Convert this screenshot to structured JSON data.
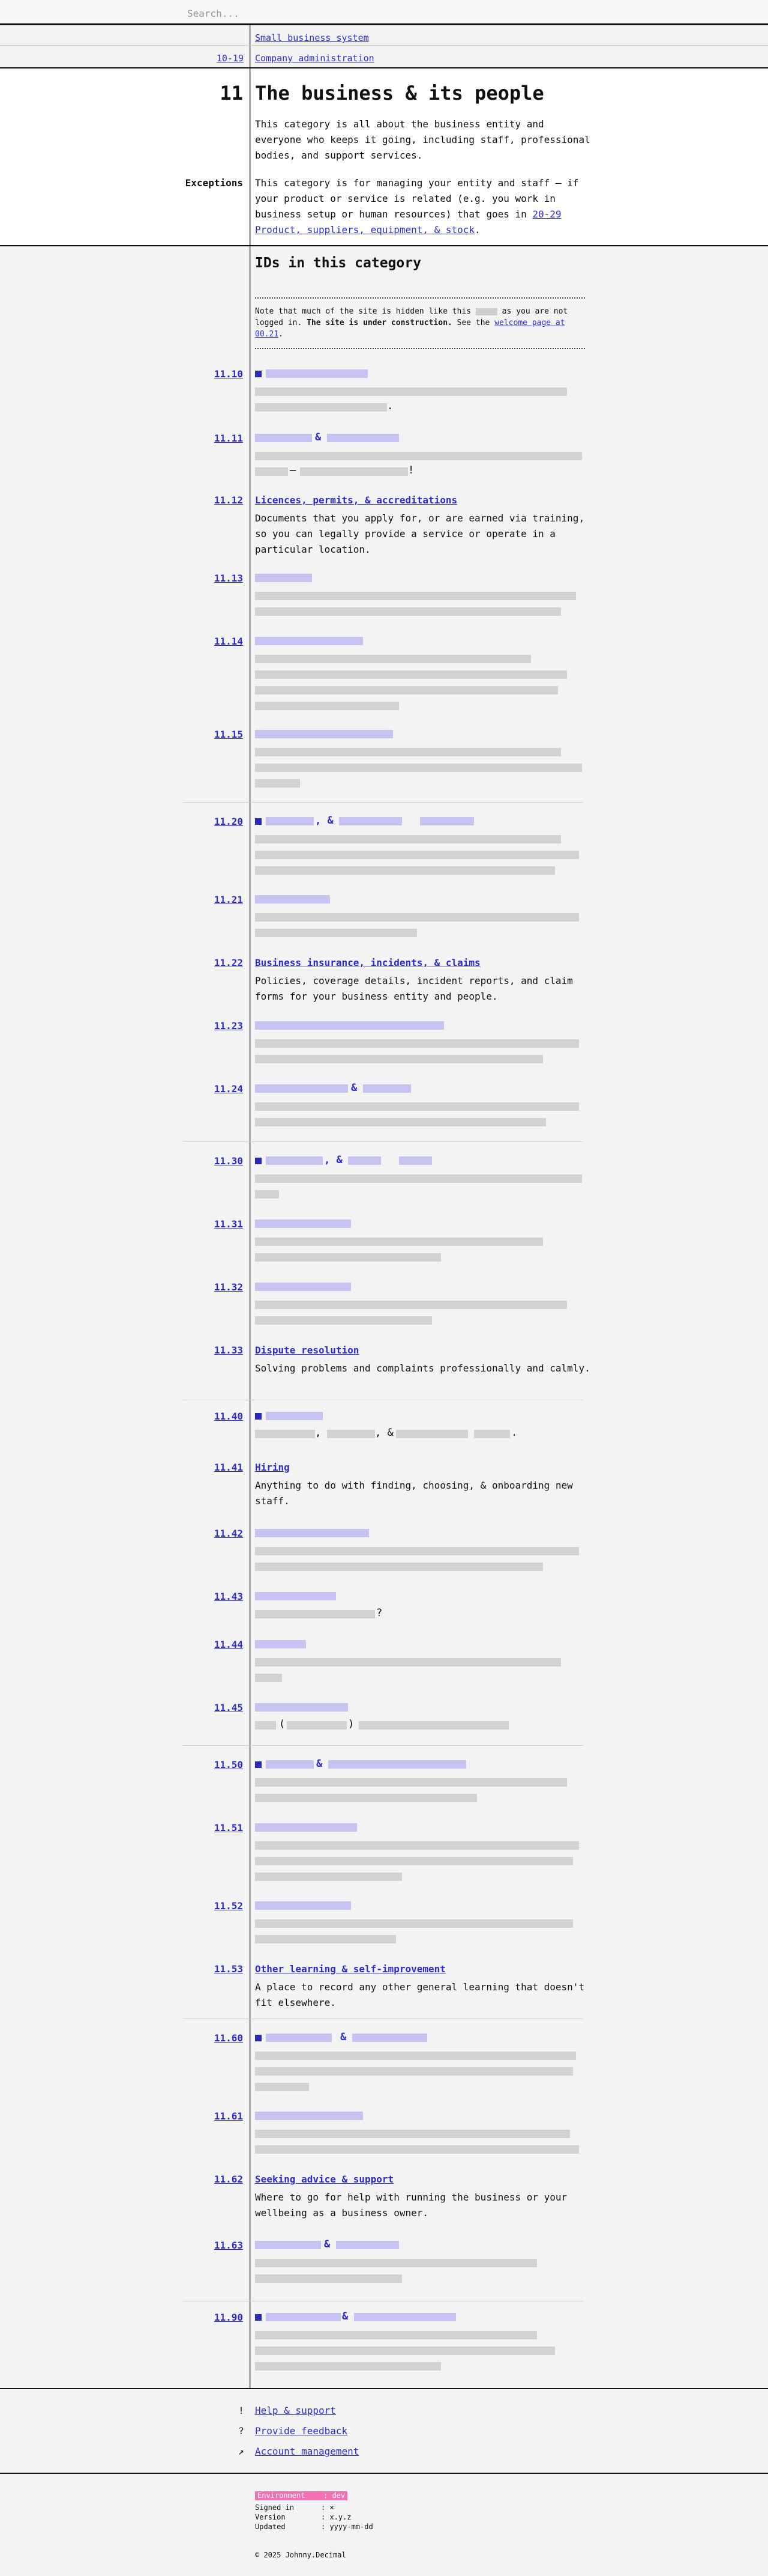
{
  "search": {
    "placeholder": "Search..."
  },
  "breadcrumbs": [
    {
      "num": "",
      "label": "Small business system"
    },
    {
      "num": "10-19",
      "label": "Company administration"
    }
  ],
  "category": {
    "number": "11",
    "title": "The business & its people",
    "description": "This category is all about the business entity and everyone who keeps it going, including staff, professional bodies, and support services.",
    "exceptions_label": "Exceptions",
    "exceptions_text_before": "This category is for managing your entity and staff – if your product or service is related (e.g. you work in business setup or human resources) that goes in ",
    "exceptions_link": "20-29 Product, suppliers, equipment, & stock",
    "exceptions_text_after": "."
  },
  "ids_heading": "IDs in this category",
  "notice": {
    "text1": "Note that much of the site is hidden like this ",
    "text2": " as you are not logged in. ",
    "bold": "The site is under construction.",
    "text3": " See the ",
    "link": "welcome page at 00.21",
    "text4": "."
  },
  "ids": [
    {
      "num": "11.10"
    },
    {
      "num": "11.11"
    },
    {
      "num": "11.12",
      "title": "Licences, permits, & accreditations",
      "desc": "Documents that you apply for, or are earned via training, so you can legally provide a service or operate in a particular location."
    },
    {
      "num": "11.13"
    },
    {
      "num": "11.14"
    },
    {
      "num": "11.15"
    },
    {
      "num": "11.20"
    },
    {
      "num": "11.21"
    },
    {
      "num": "11.22",
      "title": "Business insurance, incidents, & claims",
      "desc": "Policies, coverage details, incident reports, and claim forms for your business entity and people."
    },
    {
      "num": "11.23"
    },
    {
      "num": "11.24"
    },
    {
      "num": "11.30"
    },
    {
      "num": "11.31"
    },
    {
      "num": "11.32"
    },
    {
      "num": "11.33",
      "title": "Dispute resolution",
      "desc": "Solving problems and complaints professionally and calmly."
    },
    {
      "num": "11.40"
    },
    {
      "num": "11.41",
      "title": "Hiring",
      "desc": "Anything to do with finding, choosing, & onboarding new staff."
    },
    {
      "num": "11.42"
    },
    {
      "num": "11.43"
    },
    {
      "num": "11.44"
    },
    {
      "num": "11.45"
    },
    {
      "num": "11.50"
    },
    {
      "num": "11.51"
    },
    {
      "num": "11.52"
    },
    {
      "num": "11.53",
      "title": "Other learning & self-improvement",
      "desc": "A place to record any other general learning that doesn't fit elsewhere."
    },
    {
      "num": "11.60"
    },
    {
      "num": "11.61"
    },
    {
      "num": "11.62",
      "title": "Seeking advice & support",
      "desc": "Where to go for help with running the business or your wellbeing as a business owner."
    },
    {
      "num": "11.63"
    },
    {
      "num": "11.90"
    }
  ],
  "visible_fragments": {
    "f1111": "&",
    "f1111b": "–",
    "f1111c": "!",
    "f1120": ", & ",
    "f1124": "&",
    "f1130": ", & ",
    "f1140": ", , & ",
    "f1143": "?",
    "f1145": "( )",
    "f1150": "&",
    "f1160": "&",
    "f1163": "&",
    "f1190": "&"
  },
  "footer": {
    "links": [
      {
        "icon": "!",
        "label": "Help & support"
      },
      {
        "icon": "?",
        "label": "Provide feedback"
      },
      {
        "icon": "↗",
        "label": "Account management"
      }
    ],
    "environment_label": "Environment",
    "environment_value": ": dev",
    "meta": [
      {
        "k": "Signed in",
        "v": ": ×"
      },
      {
        "k": "Version",
        "v": ": x.y.z"
      },
      {
        "k": "Updated",
        "v": ": yyyy-mm-dd"
      }
    ],
    "copyright": "© 2025 Johnny.Decimal"
  },
  "colors": {
    "link": "#2b2bd6",
    "redacted_title": "#c6c3f2",
    "redacted_text": "#d2d2d2",
    "env_badge": "#f070b0"
  }
}
